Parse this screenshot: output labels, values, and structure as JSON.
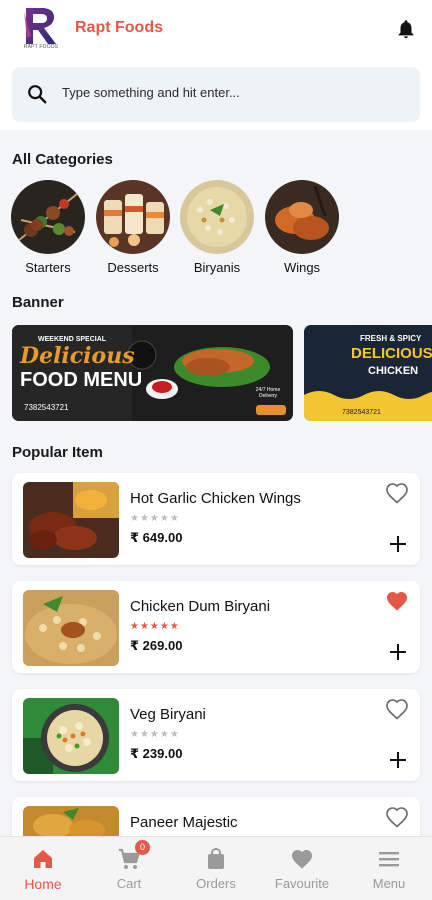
{
  "app": {
    "title": "Rapt Foods",
    "logo_text": "R",
    "logo_sub": "RAPT FOODS",
    "brand_color": "#e4584a"
  },
  "search": {
    "placeholder": "Type something and hit enter...",
    "value": ""
  },
  "categories": {
    "title": "All Categories",
    "items": [
      {
        "label": "Starters",
        "icon": "starters-image"
      },
      {
        "label": "Desserts",
        "icon": "desserts-image"
      },
      {
        "label": "Biryanis",
        "icon": "biryanis-image"
      },
      {
        "label": "Wings",
        "icon": "wings-image"
      }
    ]
  },
  "banner": {
    "title": "Banner",
    "items": [
      {
        "top_text": "WEEKEND SPECIAL",
        "headline_1": "Delicious",
        "headline_2": "FOOD MENU",
        "phone": "7382543721",
        "delivery": "24/7 Home Delivery"
      },
      {
        "top_text": "FRESH & SPICY",
        "headline_1": "DELICIOUS",
        "headline_2": "CHICKEN",
        "phone": "7382543721"
      }
    ]
  },
  "popular": {
    "title": "Popular Item",
    "items": [
      {
        "name": "Hot Garlic Chicken Wings",
        "price": "₹ 649.00",
        "rating": 0,
        "favourite": false
      },
      {
        "name": "Chicken Dum Biryani",
        "price": "₹ 269.00",
        "rating": 5,
        "favourite": true
      },
      {
        "name": "Veg Biryani",
        "price": "₹ 239.00",
        "rating": 0,
        "favourite": false
      },
      {
        "name": "Paneer Majestic",
        "price": "",
        "rating": 0,
        "favourite": false
      }
    ],
    "star_char": "★★★★★",
    "star_empty_color": "#bdbdbd",
    "star_filled_color": "#e4584a"
  },
  "nav": {
    "items": [
      {
        "label": "Home",
        "icon": "home-icon",
        "active": true
      },
      {
        "label": "Cart",
        "icon": "cart-icon",
        "active": false,
        "badge": "0"
      },
      {
        "label": "Orders",
        "icon": "bag-icon",
        "active": false
      },
      {
        "label": "Favourite",
        "icon": "heart-icon",
        "active": false
      },
      {
        "label": "Menu",
        "icon": "menu-icon",
        "active": false
      }
    ]
  }
}
